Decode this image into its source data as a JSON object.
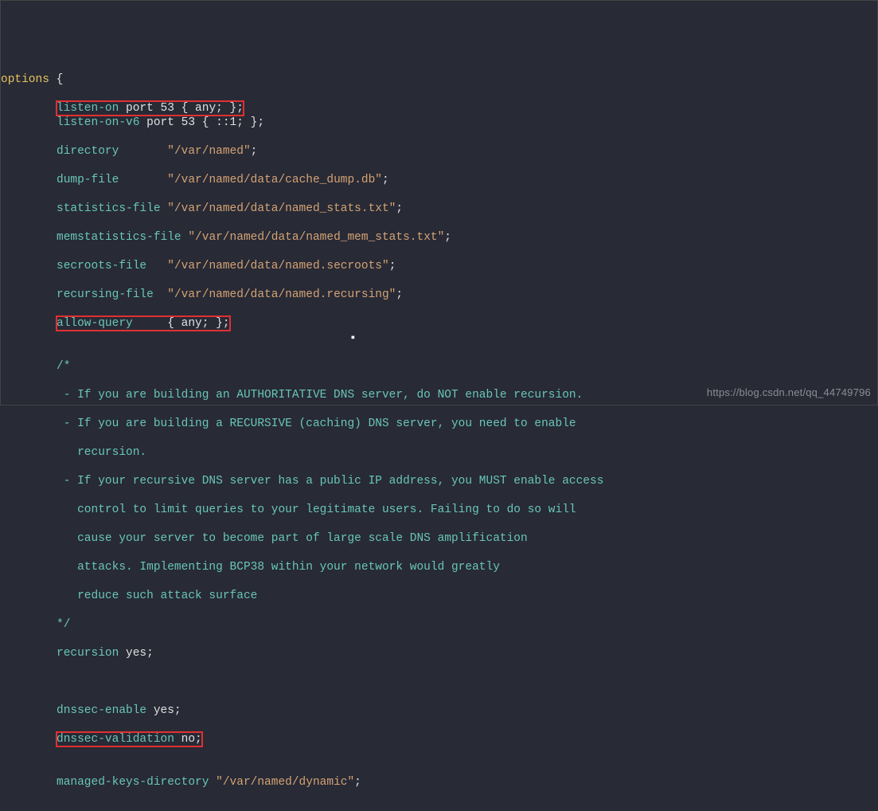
{
  "code": {
    "l1_kw": "options",
    "l1_rest": " {",
    "l2_dir": "listen-on",
    "l2_rest": " port 53 { any; };",
    "l3_dir": "listen-on-v6",
    "l3_rest": " port 53 { ::1; };",
    "l4_dir": "directory",
    "l4_pad": "       ",
    "l4_str": "\"/var/named\"",
    "l4_end": ";",
    "l5_dir": "dump-file",
    "l5_pad": "       ",
    "l5_str": "\"/var/named/data/cache_dump.db\"",
    "l5_end": ";",
    "l6_dir": "statistics-file",
    "l6_pad": " ",
    "l6_str": "\"/var/named/data/named_stats.txt\"",
    "l6_end": ";",
    "l7_dir": "memstatistics-file",
    "l7_pad": " ",
    "l7_str": "\"/var/named/data/named_mem_stats.txt\"",
    "l7_end": ";",
    "l8_dir": "secroots-file",
    "l8_pad": "   ",
    "l8_str": "\"/var/named/data/named.secroots\"",
    "l8_end": ";",
    "l9_dir": "recursing-file",
    "l9_pad": "  ",
    "l9_str": "\"/var/named/data/named.recursing\"",
    "l9_end": ";",
    "l10_dir": "allow-query",
    "l10_rest": "     { any; };",
    "c_open": "/*",
    "c1": " - If you are building an AUTHORITATIVE DNS server, do NOT enable recursion.",
    "c2": " - If you are building a RECURSIVE (caching) DNS server, you need to enable",
    "c2b": "   recursion.",
    "c3": " - If your recursive DNS server has a public IP address, you MUST enable access",
    "c4": "   control to limit queries to your legitimate users. Failing to do so will",
    "c5": "   cause your server to become part of large scale DNS amplification",
    "c6": "   attacks. Implementing BCP38 within your network would greatly",
    "c7": "   reduce such attack surface",
    "c_close": "*/",
    "r1_dir": "recursion",
    "r1_rest": " yes;",
    "d1_dir": "dnssec-enable",
    "d1_rest": " yes;",
    "d2_dir": "dnssec-validation",
    "d2_rest": " no;",
    "m1_dir": "managed-keys-directory",
    "m1_pad": " ",
    "m1_str": "\"/var/named/dynamic\"",
    "m1_end": ";"
  },
  "watermark": "https://blog.csdn.net/qq_44749796",
  "cursor": "▪"
}
